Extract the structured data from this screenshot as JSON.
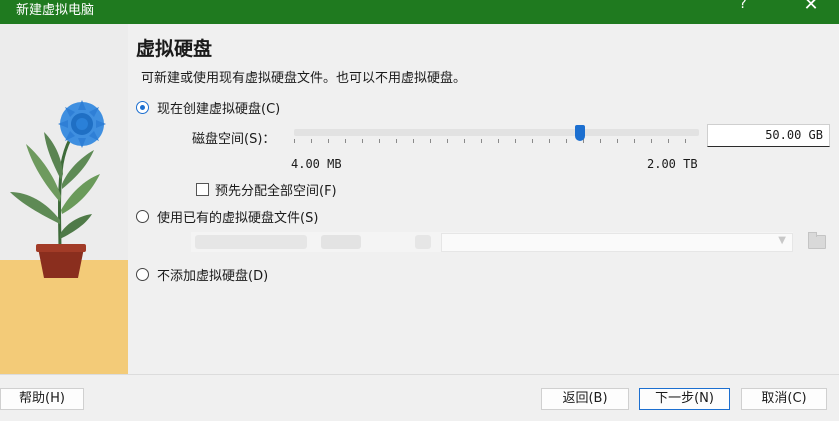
{
  "window": {
    "title": "新建虚拟电脑",
    "help_glyph": "?",
    "close_glyph": "✕",
    "titlebar_color": "#1f7a1f"
  },
  "page": {
    "heading": "虚拟硬盘",
    "subtitle": "可新建或使用现有虚拟硬盘文件。也可以不用虚拟硬盘。"
  },
  "options": {
    "create_new": {
      "label": "现在创建虚拟硬盘(C)",
      "selected": true
    },
    "use_existing": {
      "label": "使用已有的虚拟硬盘文件(S)",
      "selected": false
    },
    "no_disk": {
      "label": "不添加虚拟硬盘(D)",
      "selected": false
    }
  },
  "disk_size": {
    "label": "磁盘空间(S)：",
    "value": "50.00 GB",
    "min_label": "4.00 MB",
    "max_label": "2.00 TB",
    "slider_fraction": 0.705
  },
  "preallocate": {
    "label": "预先分配全部空间(F)",
    "checked": false
  },
  "buttons": {
    "help": "帮助(H)",
    "back": "返回(B)",
    "next": "下一步(N)",
    "cancel": "取消(C)"
  },
  "colors": {
    "accent": "#1c6fd0",
    "background": "#f0f0f0"
  },
  "icons": {
    "illustration": "potted-flower-illustration",
    "folder": "folder-icon"
  }
}
